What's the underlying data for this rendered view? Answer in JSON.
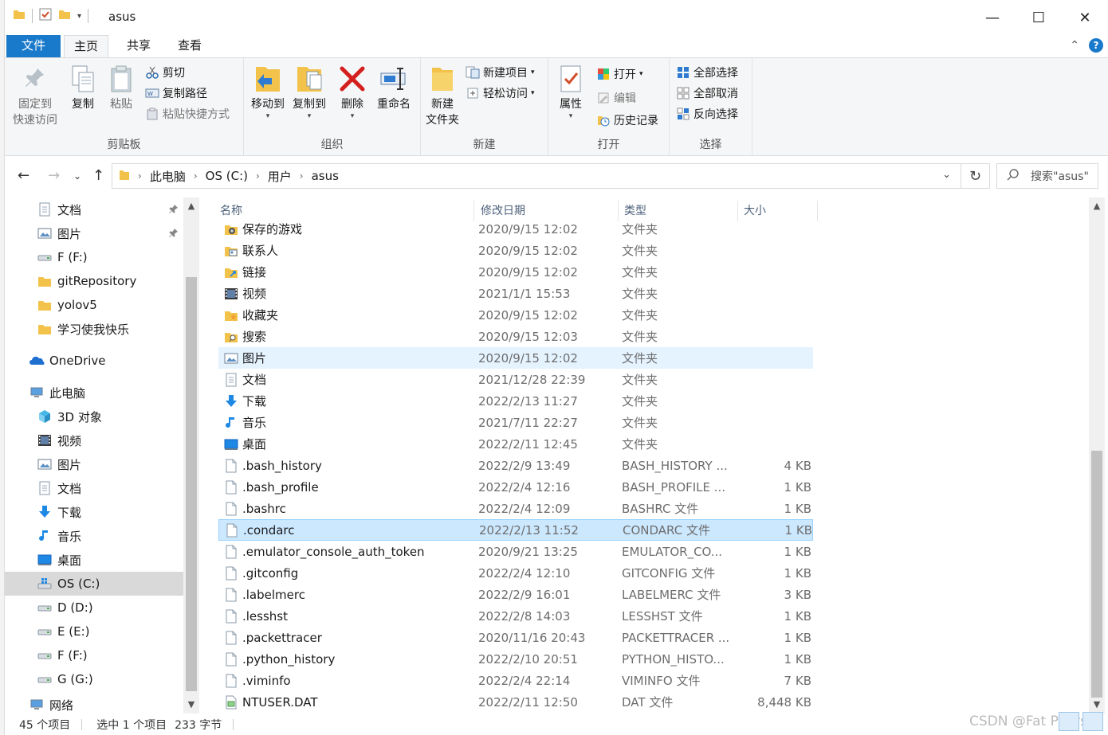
{
  "window": {
    "title": "asus",
    "minimize": "—",
    "maximize": "☐",
    "close": "✕"
  },
  "tabs": {
    "file": "文件",
    "home": "主页",
    "share": "共享",
    "view": "查看",
    "collapse": "⌃",
    "help": "?"
  },
  "ribbon": {
    "clipboard": {
      "label": "剪贴板",
      "pin": [
        "固定到",
        "快速访问"
      ],
      "copy": "复制",
      "paste": "粘贴",
      "cut": "剪切",
      "copy_path": "复制路径",
      "paste_shortcut": "粘贴快捷方式"
    },
    "organize": {
      "label": "组织",
      "move_to": "移动到",
      "copy_to": "复制到",
      "delete": "删除",
      "rename": "重命名"
    },
    "new": {
      "label": "新建",
      "new_folder": [
        "新建",
        "文件夹"
      ],
      "new_item": "新建项目",
      "easy_access": "轻松访问"
    },
    "open": {
      "label": "打开",
      "properties": "属性",
      "open": "打开",
      "edit": "编辑",
      "history": "历史记录"
    },
    "select": {
      "label": "选择",
      "select_all": "全部选择",
      "select_none": "全部取消",
      "invert": "反向选择"
    }
  },
  "address": {
    "crumbs": [
      "此电脑",
      "OS (C:)",
      "用户",
      "asus"
    ],
    "search_placeholder": "搜索\"asus\""
  },
  "nav": {
    "items": [
      {
        "label": "文档",
        "icon": "document-icon",
        "pinned": true
      },
      {
        "label": "图片",
        "icon": "pictures-icon",
        "pinned": true
      },
      {
        "label": "F (F:)",
        "icon": "drive-icon"
      },
      {
        "label": "gitRepository",
        "icon": "folder-icon"
      },
      {
        "label": "yolov5",
        "icon": "folder-icon"
      },
      {
        "label": "学习使我快乐",
        "icon": "folder-icon"
      },
      {
        "label": "OneDrive",
        "icon": "onedrive-icon"
      },
      {
        "label": "此电脑",
        "icon": "computer-icon"
      },
      {
        "label": "3D 对象",
        "icon": "3d-objects-icon"
      },
      {
        "label": "视频",
        "icon": "videos-icon"
      },
      {
        "label": "图片",
        "icon": "pictures-icon"
      },
      {
        "label": "文档",
        "icon": "document-icon"
      },
      {
        "label": "下载",
        "icon": "download-icon"
      },
      {
        "label": "音乐",
        "icon": "music-icon"
      },
      {
        "label": "桌面",
        "icon": "desktop-icon"
      },
      {
        "label": "OS (C:)",
        "icon": "windows-drive-icon"
      },
      {
        "label": "D (D:)",
        "icon": "drive-icon"
      },
      {
        "label": "E (E:)",
        "icon": "drive-icon"
      },
      {
        "label": "F (F:)",
        "icon": "drive-icon"
      },
      {
        "label": "G (G:)",
        "icon": "drive-icon"
      },
      {
        "label": "网络",
        "icon": "network-icon"
      }
    ],
    "pin_glyph": "📌"
  },
  "columns": {
    "name": "名称",
    "date": "修改日期",
    "type": "类型",
    "size": "大小"
  },
  "files": [
    {
      "name": "保存的游戏",
      "date": "2020/9/15 12:02",
      "type": "文件夹",
      "size": "",
      "icon": "saved-games-icon"
    },
    {
      "name": "联系人",
      "date": "2020/9/15 12:02",
      "type": "文件夹",
      "size": "",
      "icon": "contacts-icon"
    },
    {
      "name": "链接",
      "date": "2020/9/15 12:02",
      "type": "文件夹",
      "size": "",
      "icon": "links-icon"
    },
    {
      "name": "视频",
      "date": "2021/1/1 15:53",
      "type": "文件夹",
      "size": "",
      "icon": "videos-icon"
    },
    {
      "name": "收藏夹",
      "date": "2020/9/15 12:02",
      "type": "文件夹",
      "size": "",
      "icon": "favorites-icon"
    },
    {
      "name": "搜索",
      "date": "2020/9/15 12:03",
      "type": "文件夹",
      "size": "",
      "icon": "searches-icon"
    },
    {
      "name": "图片",
      "date": "2020/9/15 12:02",
      "type": "文件夹",
      "size": "",
      "icon": "pictures-icon"
    },
    {
      "name": "文档",
      "date": "2021/12/28 22:39",
      "type": "文件夹",
      "size": "",
      "icon": "document-icon"
    },
    {
      "name": "下载",
      "date": "2022/2/13 11:27",
      "type": "文件夹",
      "size": "",
      "icon": "download-icon"
    },
    {
      "name": "音乐",
      "date": "2021/7/11 22:27",
      "type": "文件夹",
      "size": "",
      "icon": "music-icon"
    },
    {
      "name": "桌面",
      "date": "2022/2/11 12:45",
      "type": "文件夹",
      "size": "",
      "icon": "desktop-icon"
    },
    {
      "name": ".bash_history",
      "date": "2022/2/9 13:49",
      "type": "BASH_HISTORY ...",
      "size": "4 KB",
      "icon": "file-icon"
    },
    {
      "name": ".bash_profile",
      "date": "2022/2/4 12:16",
      "type": "BASH_PROFILE ...",
      "size": "1 KB",
      "icon": "file-icon"
    },
    {
      "name": ".bashrc",
      "date": "2022/2/4 12:09",
      "type": "BASHRC 文件",
      "size": "1 KB",
      "icon": "file-icon"
    },
    {
      "name": ".condarc",
      "date": "2022/2/13 11:52",
      "type": "CONDARC 文件",
      "size": "1 KB",
      "icon": "file-icon"
    },
    {
      "name": ".emulator_console_auth_token",
      "date": "2020/9/21 13:25",
      "type": "EMULATOR_CO...",
      "size": "1 KB",
      "icon": "file-icon"
    },
    {
      "name": ".gitconfig",
      "date": "2022/2/4 12:10",
      "type": "GITCONFIG 文件",
      "size": "1 KB",
      "icon": "file-icon"
    },
    {
      "name": ".labelmerc",
      "date": "2022/2/9 16:01",
      "type": "LABELMERC 文件",
      "size": "3 KB",
      "icon": "file-icon"
    },
    {
      "name": ".lesshst",
      "date": "2022/2/8 14:03",
      "type": "LESSHST 文件",
      "size": "1 KB",
      "icon": "file-icon"
    },
    {
      "name": ".packettracer",
      "date": "2020/11/16 20:43",
      "type": "PACKETTRACER ...",
      "size": "1 KB",
      "icon": "file-icon"
    },
    {
      "name": ".python_history",
      "date": "2022/2/10 20:51",
      "type": "PYTHON_HISTO...",
      "size": "1 KB",
      "icon": "file-icon"
    },
    {
      "name": ".viminfo",
      "date": "2022/2/4 22:14",
      "type": "VIMINFO 文件",
      "size": "7 KB",
      "icon": "file-icon"
    },
    {
      "name": "NTUSER.DAT",
      "date": "2022/2/11 12:50",
      "type": "DAT 文件",
      "size": "8,448 KB",
      "icon": "dat-file-icon"
    }
  ],
  "selected_file": ".condarc",
  "hovered_file": "图片",
  "status": {
    "count": "45 个项目",
    "selection": "选中 1 个项目",
    "size": "233 字节"
  },
  "watermark": "CSDN @Fat Pears",
  "colors": {
    "accent": "#1979ca",
    "selected_row": "#cce8ff",
    "hover_row": "#e5f3ff",
    "folder": "#f3c24a"
  }
}
